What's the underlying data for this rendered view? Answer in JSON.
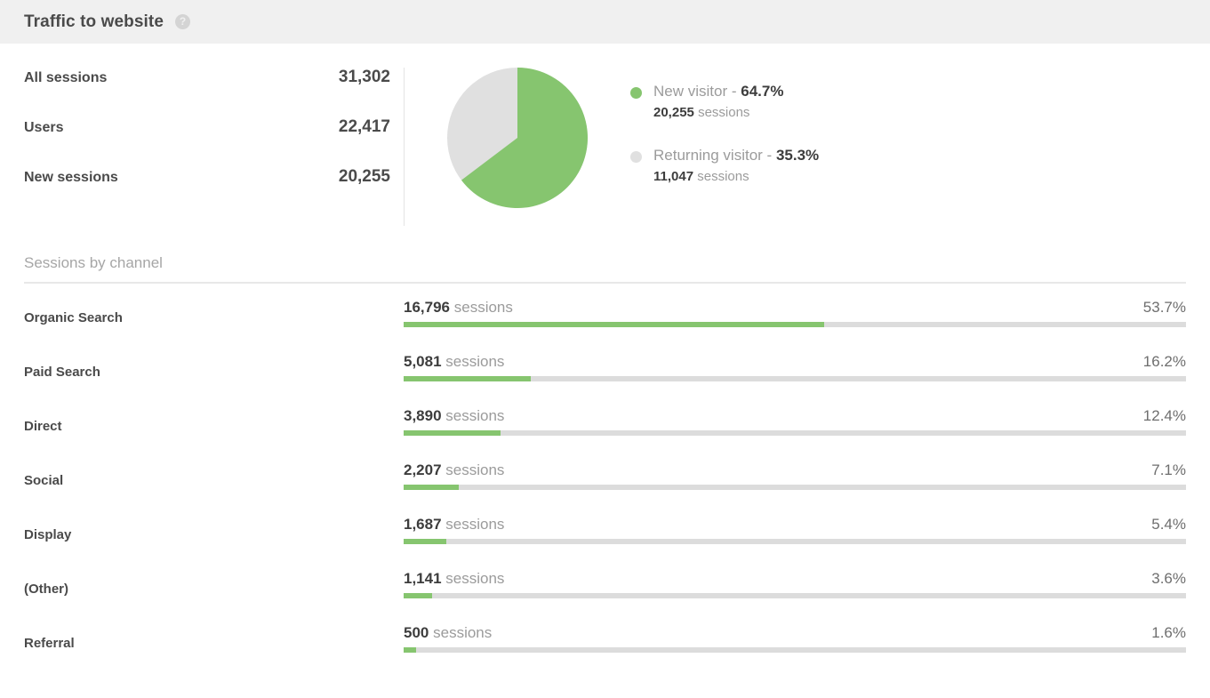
{
  "header": {
    "title": "Traffic to website",
    "help_icon": "help-circle-icon",
    "help_glyph": "?"
  },
  "summary": {
    "stats": [
      {
        "label": "All sessions",
        "value": "31,302"
      },
      {
        "label": "Users",
        "value": "22,417"
      },
      {
        "label": "New sessions",
        "value": "20,255"
      }
    ],
    "legend": [
      {
        "name": "New visitor",
        "separator": " - ",
        "percent": "64.7%",
        "sessions_value": "20,255",
        "sessions_word": "sessions",
        "color": "#86c56f"
      },
      {
        "name": "Returning visitor",
        "separator": " - ",
        "percent": "35.3%",
        "sessions_value": "11,047",
        "sessions_word": "sessions",
        "color": "#e0e0e0"
      }
    ]
  },
  "section": {
    "title": "Sessions by channel"
  },
  "channels": [
    {
      "name": "Organic Search",
      "sessions_value": "16,796",
      "sessions_word": "sessions",
      "percent_label": "53.7%",
      "percent": 53.7
    },
    {
      "name": "Paid Search",
      "sessions_value": "5,081",
      "sessions_word": "sessions",
      "percent_label": "16.2%",
      "percent": 16.2
    },
    {
      "name": "Direct",
      "sessions_value": "3,890",
      "sessions_word": "sessions",
      "percent_label": "12.4%",
      "percent": 12.4
    },
    {
      "name": "Social",
      "sessions_value": "2,207",
      "sessions_word": "sessions",
      "percent_label": "7.1%",
      "percent": 7.1
    },
    {
      "name": "Display",
      "sessions_value": "1,687",
      "sessions_word": "sessions",
      "percent_label": "5.4%",
      "percent": 5.4
    },
    {
      "name": "(Other)",
      "sessions_value": "1,141",
      "sessions_word": "sessions",
      "percent_label": "3.6%",
      "percent": 3.6
    },
    {
      "name": "Referral",
      "sessions_value": "500",
      "sessions_word": "sessions",
      "percent_label": "1.6%",
      "percent": 1.6
    }
  ],
  "colors": {
    "accent_green": "#86c56f",
    "track_gray": "#dcdcdc",
    "pie_gray": "#e0e0e0",
    "header_bg": "#f0f0f0",
    "text_dark": "#4a4a4a",
    "text_muted": "#9b9b9b"
  },
  "chart_data": [
    {
      "type": "pie",
      "title": "",
      "labels": [
        "New visitor",
        "Returning visitor"
      ],
      "values": [
        64.7,
        35.3
      ],
      "raw_sessions": [
        20255,
        11047
      ],
      "colors": [
        "#86c56f",
        "#e0e0e0"
      ],
      "legend": "right",
      "start_angle_deg": 0,
      "direction": "clockwise"
    },
    {
      "type": "bar",
      "title": "Sessions by channel",
      "orientation": "horizontal",
      "categories": [
        "Organic Search",
        "Paid Search",
        "Direct",
        "Social",
        "Display",
        "(Other)",
        "Referral"
      ],
      "values": [
        16796,
        5081,
        3890,
        2207,
        1687,
        1141,
        500
      ],
      "percent_values": [
        53.7,
        16.2,
        12.4,
        7.1,
        5.4,
        3.6,
        1.6
      ],
      "xlabel": "",
      "ylabel": "",
      "xlim": [
        0,
        100
      ],
      "grid": false,
      "bar_color": "#86c56f",
      "track_color": "#dcdcdc"
    }
  ]
}
